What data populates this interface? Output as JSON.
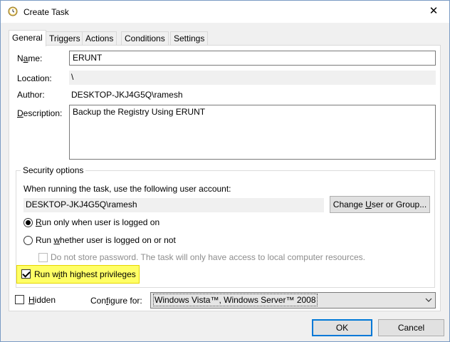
{
  "window": {
    "title": "Create Task"
  },
  "tabs": [
    {
      "label": "General",
      "active": true
    },
    {
      "label": "Triggers",
      "active": false
    },
    {
      "label": "Actions",
      "active": false
    },
    {
      "label": "Conditions",
      "active": false
    },
    {
      "label": "Settings",
      "active": false
    }
  ],
  "general": {
    "name_label_pre": "N",
    "name_label_u": "a",
    "name_label_post": "me:",
    "name_value": "ERUNT",
    "location_label": "Location:",
    "location_value": "\\",
    "author_label": "Author:",
    "author_value": "DESKTOP-JKJ4G5Q\\ramesh",
    "description_label_u": "D",
    "description_label_post": "escription:",
    "description_value": "Backup the Registry Using ERUNT"
  },
  "security": {
    "title": "Security options",
    "account_prompt": "When running the task, use the following user account:",
    "account_value": "DESKTOP-JKJ4G5Q\\ramesh",
    "change_button_pre": "Change ",
    "change_button_u": "U",
    "change_button_post": "ser or Group...",
    "radio_logged_on_u": "R",
    "radio_logged_on_post": "un only when user is logged on",
    "radio_whether_pre": "Run ",
    "radio_whether_u": "w",
    "radio_whether_post": "hether user is logged on or not",
    "no_store_password": "Do not store password.  The task will only have access to local computer resources.",
    "highest_pre": "Run w",
    "highest_u": "i",
    "highest_post": "th highest privileges"
  },
  "bottom": {
    "hidden_u": "H",
    "hidden_post": "idden",
    "configure_pre": "Con",
    "configure_u": "f",
    "configure_post": "igure for:",
    "configure_value": "Windows Vista™, Windows Server™ 2008",
    "ok_label": "OK",
    "cancel_label": "Cancel"
  },
  "state": {
    "run_only_logged_on": true,
    "run_whether": false,
    "do_not_store_password": false,
    "highest_privileges": true,
    "hidden": false
  },
  "colors": {
    "highlight": "#ffff66",
    "primary_border": "#0078d7"
  }
}
